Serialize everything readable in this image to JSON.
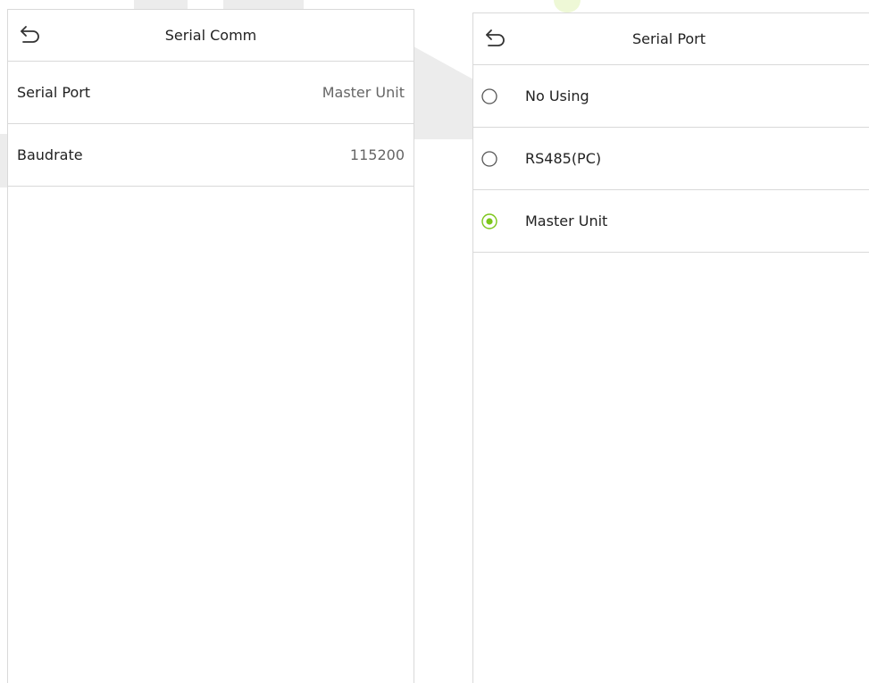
{
  "left_screen": {
    "title": "Serial Comm",
    "items": [
      {
        "label": "Serial Port",
        "value": "Master Unit"
      },
      {
        "label": "Baudrate",
        "value": "115200"
      }
    ]
  },
  "right_screen": {
    "title": "Serial Port",
    "options": [
      {
        "label": "No Using",
        "selected": false
      },
      {
        "label": "RS485(PC)",
        "selected": false
      },
      {
        "label": "Master Unit",
        "selected": true
      }
    ]
  },
  "colors": {
    "accent": "#7cc61a",
    "border": "#d9d9d9",
    "radio_off": "#555555"
  },
  "icons": {
    "back": "back-arrow-icon",
    "radio_on": "radio-selected-icon",
    "radio_off": "radio-unselected-icon"
  }
}
